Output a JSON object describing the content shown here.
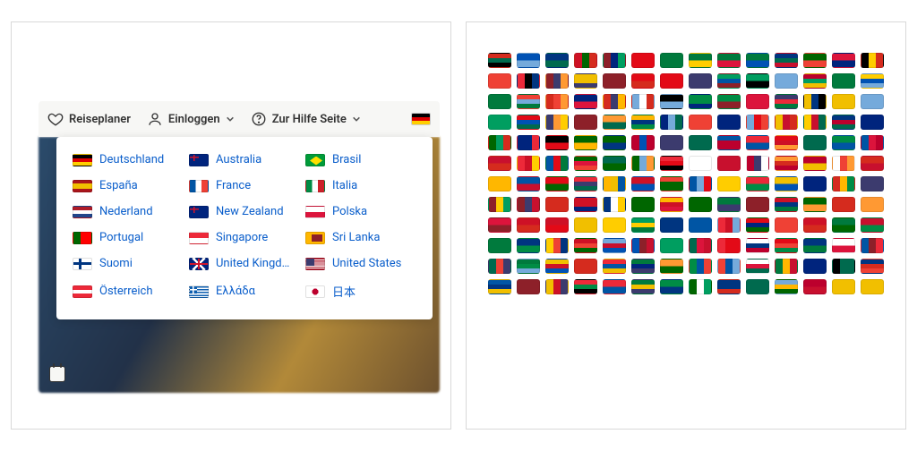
{
  "header": {
    "planner_label": "Reiseplaner",
    "login_label": "Einloggen",
    "help_label": "Zur Hilfe Seite"
  },
  "countries": [
    {
      "label": "Deutschland",
      "flag_class": "flag-de"
    },
    {
      "label": "Australia",
      "flag_class": "flag-au"
    },
    {
      "label": "Brasil",
      "flag_class": "flag-br"
    },
    {
      "label": "España",
      "flag_class": "flag-es"
    },
    {
      "label": "France",
      "flag_class": "flag-fr"
    },
    {
      "label": "Italia",
      "flag_class": "flag-it"
    },
    {
      "label": "Nederland",
      "flag_class": "flag-nl"
    },
    {
      "label": "New Zealand",
      "flag_class": "flag-nz"
    },
    {
      "label": "Polska",
      "flag_class": "flag-pl"
    },
    {
      "label": "Portugal",
      "flag_class": "flag-pt"
    },
    {
      "label": "Singapore",
      "flag_class": "flag-sg"
    },
    {
      "label": "Sri Lanka",
      "flag_class": "flag-lk"
    },
    {
      "label": "Suomi",
      "flag_class": "flag-fi"
    },
    {
      "label": "United Kingd…",
      "flag_class": "flag-gb"
    },
    {
      "label": "United States",
      "flag_class": "flag-us"
    },
    {
      "label": "Österreich",
      "flag_class": "flag-at"
    },
    {
      "label": "Ελλάδα",
      "flag_class": "flag-gr"
    },
    {
      "label": "日本",
      "flag_class": "flag-jp"
    }
  ],
  "grid_flag_count": 168,
  "grid_palette": [
    "#d52b1e",
    "#0052b4",
    "#009e60",
    "#ffcd00",
    "#ffffff",
    "#000000",
    "#ff9933",
    "#006a4e",
    "#ce1126",
    "#003580",
    "#75aadb",
    "#f1bf00",
    "#3c3b6e",
    "#e30a17",
    "#007a3d",
    "#c8102e",
    "#00247d",
    "#ed2939",
    "#008c45",
    "#ef4135",
    "#0055a4",
    "#dc143c",
    "#bc002d",
    "#006600",
    "#8d2029",
    "#ffb700"
  ]
}
